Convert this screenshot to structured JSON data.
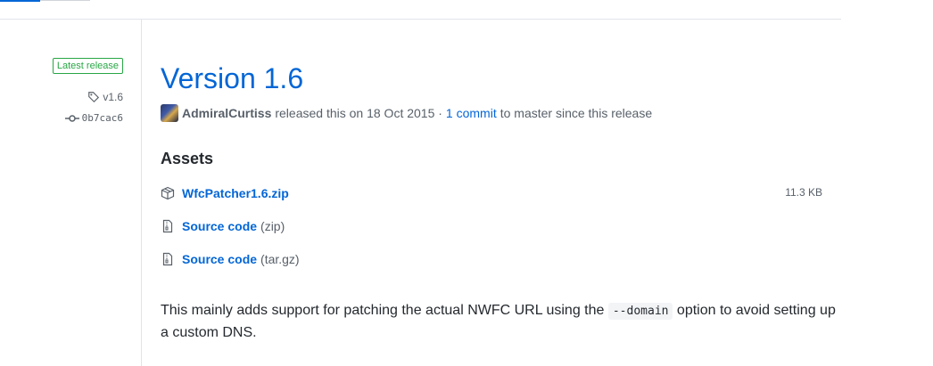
{
  "sidebar": {
    "badge": "Latest release",
    "tag": "v1.6",
    "commit": "0b7cac6"
  },
  "release": {
    "title": "Version 1.6",
    "author": "AdmiralCurtiss",
    "released_text": "released this on 18 Oct 2015 ·",
    "commits_link": "1 commit",
    "commits_suffix": "to master since this release"
  },
  "assets": {
    "heading": "Assets",
    "items": [
      {
        "name": "WfcPatcher1.6.zip",
        "format": "",
        "size": "11.3 KB",
        "icon": "package-icon"
      },
      {
        "name": "Source code",
        "format": "(zip)",
        "icon": "file-zip-icon"
      },
      {
        "name": "Source code",
        "format": "(tar.gz)",
        "icon": "file-zip-icon"
      }
    ]
  },
  "notes": {
    "before": "This mainly adds support for patching the actual NWFC URL using the ",
    "code": "--domain",
    "after": " option to avoid setting up a custom DNS."
  },
  "colors": {
    "link": "#0366d6",
    "badge_green": "#28a745",
    "muted": "#586069",
    "text": "#24292e"
  }
}
